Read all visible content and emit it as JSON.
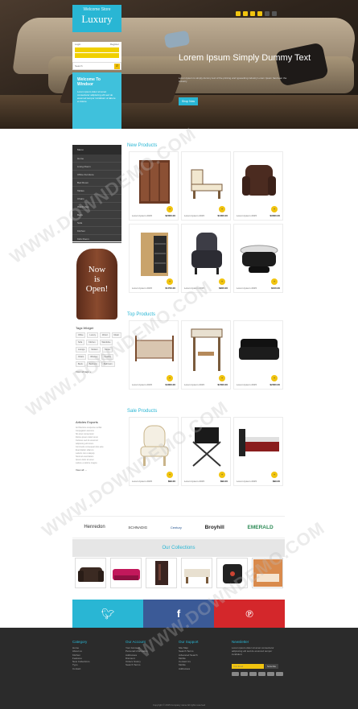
{
  "header": {
    "logo_small": "Welcome Store",
    "logo": "Luxury",
    "login": "Login",
    "register": "Register",
    "search_placeholder": "Search",
    "welcome_title": "Welcome To Windsor",
    "welcome_text": "Lorem ipsum dolor sit amet consectetur adipiscing elit sed do eiusmod tempor incididunt ut labore et dolore"
  },
  "hero": {
    "title": "Lorem Ipsum Simply Dummy Text",
    "text": "Lorem Ipsum is simply dummy text of the printing and typesetting industry Lorem Ipsum has been the industry",
    "button": "Shop Now",
    "slide_active": 1
  },
  "sidebar": {
    "heading": "Menu",
    "items": [
      "Home",
      "Living Room",
      "Office Furniture",
      "Bed Room",
      "Tables",
      "Chairs",
      "Wardrobes",
      "Beds",
      "Sofa",
      "Kitchen",
      "Kids Room"
    ]
  },
  "promo": {
    "line1": "Now",
    "line2": "is",
    "line3": "Open!"
  },
  "sections": {
    "new_products": "New Products",
    "top_products": "Top Products",
    "sale_products": "Sale Products"
  },
  "products": {
    "new": [
      {
        "name": "Lorem Ipsum 2015",
        "price": "$2000.00",
        "icon": "wardrobe"
      },
      {
        "name": "Lorem Ipsum 2015",
        "price": "$1000.00",
        "icon": "lounge-chair"
      },
      {
        "name": "Lorem Ipsum 2015",
        "price": "$3000.00",
        "icon": "recliner"
      },
      {
        "name": "Lorem Ipsum 2015",
        "price": "$1700.00",
        "icon": "shoe-cabinet"
      },
      {
        "name": "Lorem Ipsum 2015",
        "price": "$900.00",
        "icon": "armchair"
      },
      {
        "name": "Lorem Ipsum 2015",
        "price": "$100.00",
        "icon": "ottoman"
      }
    ],
    "top": [
      {
        "name": "Lorem Ipsum 2015",
        "price": "$4000.00",
        "icon": "bed"
      },
      {
        "name": "Lorem Ipsum 2015",
        "price": "$1500.00",
        "icon": "loft-bed"
      },
      {
        "name": "Lorem Ipsum 2015",
        "price": "$2000.00",
        "icon": "leather-sofa"
      }
    ],
    "sale": [
      {
        "name": "Lorem Ipsum 2015",
        "price": "$99.00",
        "icon": "white-chair"
      },
      {
        "name": "Lorem Ipsum 2015",
        "price": "$99.00",
        "icon": "camp-chair"
      },
      {
        "name": "Lorem Ipsum 2015",
        "price": "$99.00",
        "icon": "bed-frame"
      }
    ]
  },
  "tags_widget": {
    "title": "Tags Widget",
    "tags": [
      "Office",
      "Luxury",
      "Wood",
      "Metal",
      "Sofa",
      "Kitchen",
      "Wardrobe",
      "Lounge",
      "Modern",
      "Tables",
      "Chairs",
      "Windsor",
      "Flexible",
      "Beds",
      "Bedroom",
      "Bathroom"
    ],
    "view_all": "View all tags »"
  },
  "articles": {
    "title": "Articles Exports",
    "lines": [
      "Architecture suspense verbal",
      "Conjugation demons",
      "Sit amet consectetur",
      "Dolore ipsum dolor lorem",
      "Cultures sed do eiusmod",
      "Adipiscing elit lorem",
      "Commodo consequat duis aute",
      "Exercitation ullamco",
      "Laboris nisi ut aliquip",
      "Nostrud exercitation",
      "Ipsum dolor sit amet",
      "Labore et dolore magna"
    ],
    "view_all": "View all →"
  },
  "brands": [
    "Henredon",
    "SCHNADIG",
    "Century",
    "Broyhill",
    "EMERALD"
  ],
  "collections": {
    "title": "Our Collections"
  },
  "footer": {
    "category": {
      "title": "Category",
      "items": [
        "Home",
        "About us",
        "Kitchen",
        "Features",
        "New Collections",
        "Typo",
        "Contact"
      ]
    },
    "account": {
      "title": "Our Account",
      "items": [
        "Your Account",
        "Personal information",
        "Addresses",
        "Discount",
        "Orders history",
        "Search Terms"
      ]
    },
    "support": {
      "title": "Our Support",
      "items": [
        "Site Map",
        "Search Terms",
        "Advanced Search",
        "Mobile",
        "Contact Us",
        "Mobile",
        "Addresses"
      ]
    },
    "newsletter": {
      "title": "Newsletter",
      "text": "Lorem ipsum dolor sit amet consectetur adipiscing elit sed do eiusmod tempor incididunt",
      "placeholder": "Your Email",
      "button": "Subscribe"
    },
    "copyright": "Copyright © 2015 Company name All rights reserved"
  },
  "watermark": "WWW.DOWNDEMO.COM",
  "colors": {
    "accent": "#29b6d4",
    "yellow": "#f1c40f",
    "footer": "#2b2b2b"
  }
}
